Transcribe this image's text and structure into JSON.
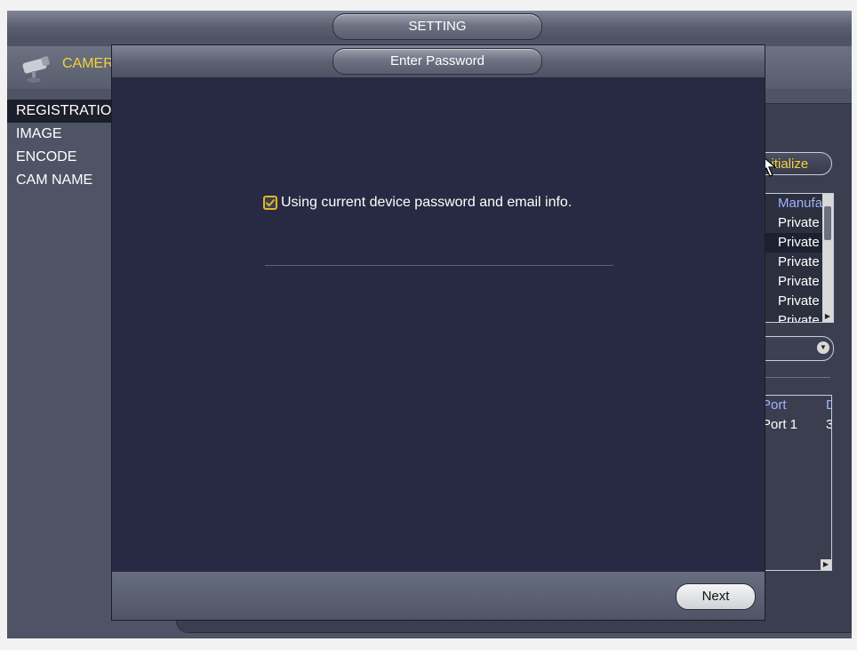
{
  "window": {
    "title": "SETTING"
  },
  "camera": {
    "label": "CAMERA"
  },
  "sidebar": {
    "items": [
      {
        "label": "REGISTRATION",
        "active": true
      },
      {
        "label": "IMAGE",
        "active": false
      },
      {
        "label": "ENCODE",
        "active": false
      },
      {
        "label": "CAM NAME",
        "active": false
      }
    ]
  },
  "background": {
    "initialize_label": "Initialize",
    "list_header": "Manufacturer",
    "list_rows": [
      "Private",
      "Private",
      "Private",
      "Private",
      "Private",
      "Private"
    ],
    "port_header": "Port",
    "port_value": "Port 1",
    "port_col2_header": "D",
    "port_col2_value": "3"
  },
  "dialog": {
    "title": "Enter Password",
    "checkbox_label": "Using current device password and email info.",
    "checkbox_checked": true,
    "next_label": "Next"
  },
  "colors": {
    "accent": "#f5d13b",
    "checkbox": "#e2b52a",
    "dialog_bg": "#272a42"
  }
}
